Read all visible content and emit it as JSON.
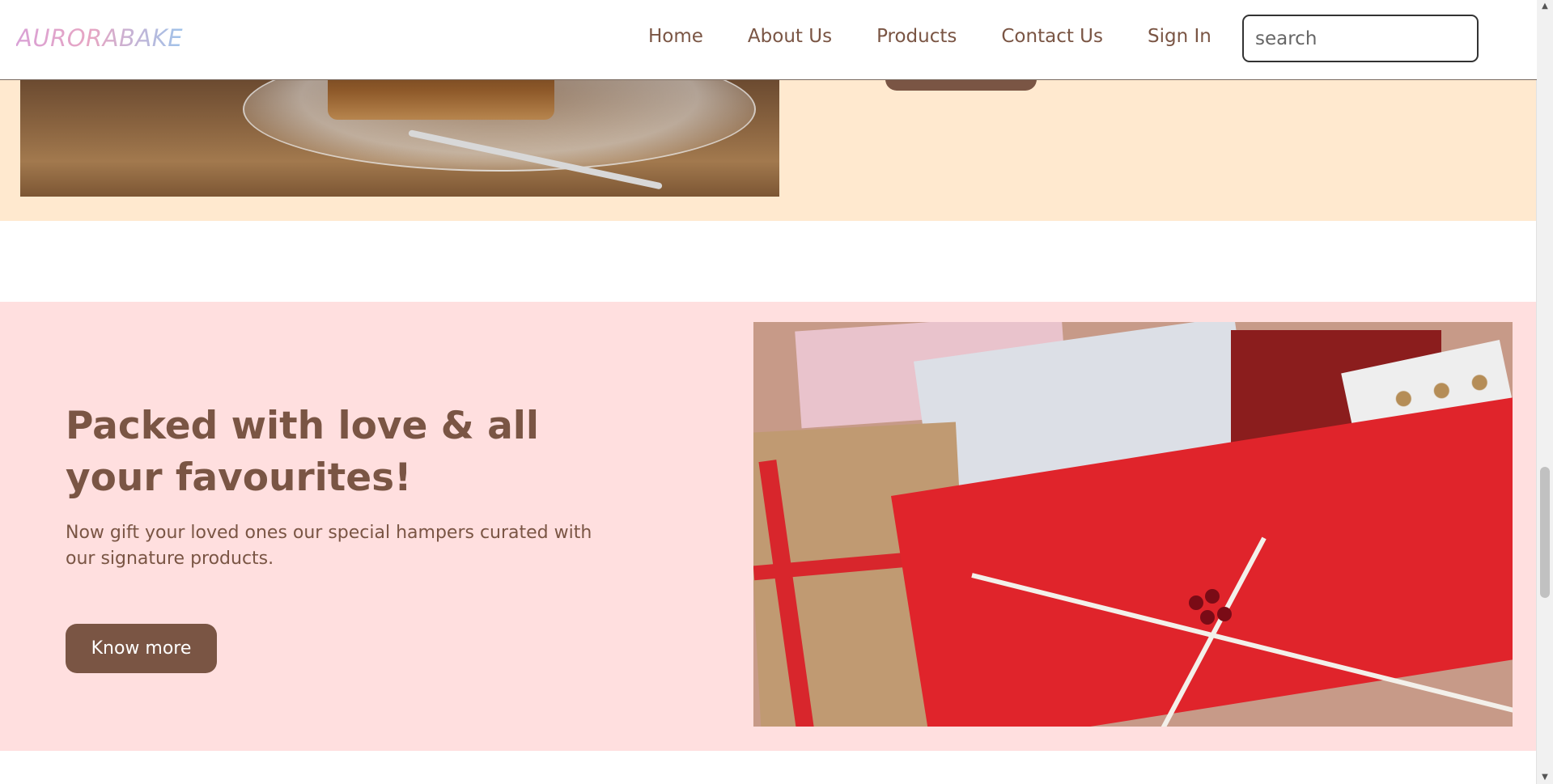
{
  "nav": {
    "logo": "AURORABAKE",
    "items": [
      "Home",
      "About Us",
      "Products",
      "Contact Us",
      "Sign In"
    ],
    "search_placeholder": "search"
  },
  "hamper_section": {
    "headline": "Packed with love & all your favourites!",
    "description": "Now gift your loved ones our special hampers curated with our signature products.",
    "button_label": "Know more"
  },
  "colors": {
    "brand_brown": "#7a5544",
    "peach_band": "#ffe9cf",
    "pink_band": "#ffdfdf"
  },
  "scrollbar": {
    "up_icon": "▲",
    "down_icon": "▼"
  }
}
